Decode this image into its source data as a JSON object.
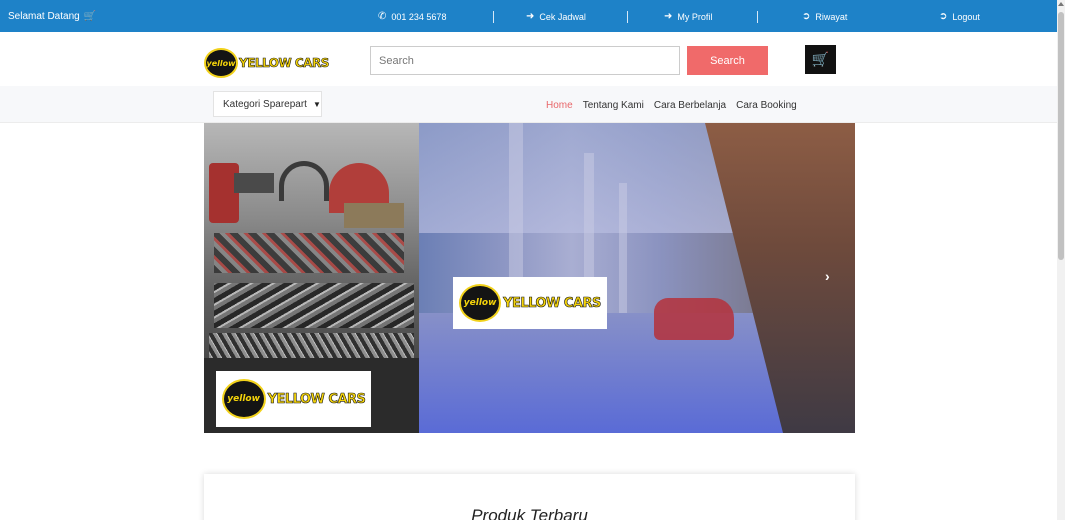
{
  "topbar": {
    "welcome": "Selamat Datang",
    "phone": "001 234 5678",
    "cek_jadwal": "Cek Jadwal",
    "my_profil": "My Profil",
    "riwayat": "Riwayat",
    "logout": "Logout"
  },
  "header": {
    "logo_badge": "yellow",
    "logo_text": "YELLOW CARS",
    "search_placeholder": "Search",
    "search_button": "Search"
  },
  "nav": {
    "kategori": "Kategori Sparepart",
    "menu": [
      "Home",
      "Tentang Kami",
      "Cara Berbelanja",
      "Cara Booking"
    ]
  },
  "banner": {
    "logo_badge": "yellow",
    "logo_text": "YELLOW CARS"
  },
  "products": {
    "title": "Produk Terbaru"
  },
  "colors": {
    "topbar": "#1e82c8",
    "search_button": "#f06a6a",
    "active_menu": "#e8676a",
    "logo_yellow": "#f5d40a"
  }
}
